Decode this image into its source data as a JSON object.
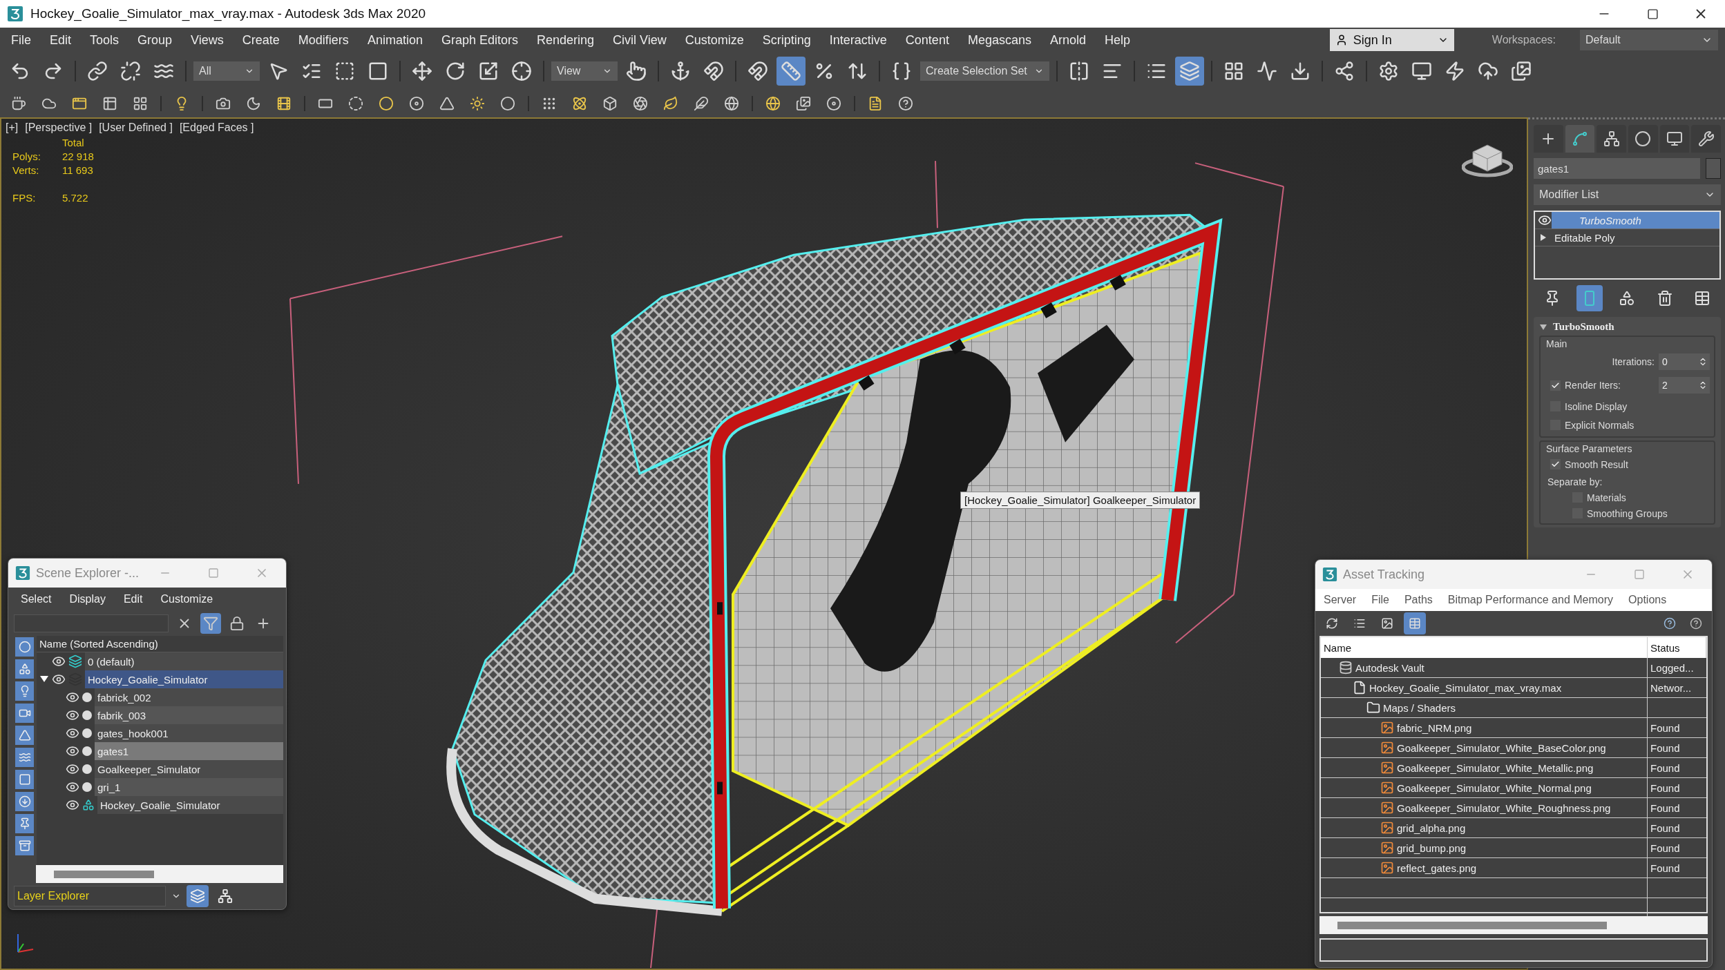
{
  "window": {
    "title": "Hockey_Goalie_Simulator_max_vray.max - Autodesk 3ds Max 2020"
  },
  "menu_bar": [
    "File",
    "Edit",
    "Tools",
    "Group",
    "Views",
    "Create",
    "Modifiers",
    "Animation",
    "Graph Editors",
    "Rendering",
    "Civil View",
    "Customize",
    "Scripting",
    "Interactive",
    "Content",
    "Megascans",
    "Arnold",
    "Help"
  ],
  "sign_in": {
    "label": "Sign In"
  },
  "workspaces": {
    "label": "Workspaces:",
    "value": "Default"
  },
  "main_toolbar": [
    {
      "items": [
        {
          "kind": "tool",
          "selected": false
        },
        {
          "kind": "tool",
          "selected": false
        }
      ]
    },
    {
      "items": [
        {
          "kind": "tool",
          "selected": false
        },
        {
          "kind": "tool",
          "selected": false
        },
        {
          "kind": "tool",
          "selected": false
        }
      ]
    },
    {
      "items": [
        {
          "kind": "dropdown",
          "value": "All"
        },
        {
          "kind": "tool",
          "selected": false
        },
        {
          "kind": "tool",
          "selected": false
        },
        {
          "kind": "tool",
          "selected": false
        },
        {
          "kind": "tool",
          "selected": false
        }
      ]
    },
    {
      "items": [
        {
          "kind": "tool",
          "selected": false
        },
        {
          "kind": "tool",
          "selected": false
        },
        {
          "kind": "tool",
          "selected": false
        },
        {
          "kind": "tool",
          "selected": false
        }
      ]
    },
    {
      "items": [
        {
          "kind": "dropdown",
          "value": "View"
        },
        {
          "kind": "tool",
          "selected": false
        }
      ]
    },
    {
      "items": [
        {
          "kind": "tool",
          "selected": false
        },
        {
          "kind": "tool",
          "selected": false
        }
      ]
    },
    {
      "items": [
        {
          "kind": "tool",
          "selected": false
        },
        {
          "kind": "tool",
          "selected": true
        },
        {
          "kind": "tool",
          "selected": false
        },
        {
          "kind": "tool",
          "selected": false
        }
      ]
    },
    {
      "items": [
        {
          "kind": "tool",
          "selected": false
        },
        {
          "kind": "dropdown",
          "value": "Create Selection Set"
        }
      ]
    },
    {
      "items": [
        {
          "kind": "tool",
          "selected": false
        },
        {
          "kind": "tool",
          "selected": false
        }
      ]
    },
    {
      "items": [
        {
          "kind": "tool",
          "selected": false
        },
        {
          "kind": "tool",
          "selected": true
        }
      ]
    },
    {
      "items": [
        {
          "kind": "tool",
          "selected": false
        },
        {
          "kind": "tool",
          "selected": false
        },
        {
          "kind": "tool",
          "selected": false
        }
      ]
    },
    {
      "items": [
        {
          "kind": "tool",
          "selected": false
        }
      ]
    },
    {
      "items": [
        {
          "kind": "tool",
          "selected": false
        },
        {
          "kind": "tool",
          "selected": false
        },
        {
          "kind": "tool",
          "selected": false
        },
        {
          "kind": "tool",
          "selected": false
        },
        {
          "kind": "tool",
          "selected": false
        }
      ]
    }
  ],
  "viewport": {
    "labels": [
      "[+]",
      "[Perspective ]",
      "[User Defined ]",
      "[Edged Faces ]"
    ],
    "stats": {
      "header": "Total",
      "rows": [
        {
          "label": "Polys:",
          "value": "22 918"
        },
        {
          "label": "Verts:",
          "value": "11 693"
        }
      ],
      "fps": {
        "label": "FPS:",
        "value": "5.722"
      }
    },
    "tooltip": "[Hockey_Goalie_Simulator] Goalkeeper_Simulator"
  },
  "command_panel": {
    "tabs": [
      {
        "selected": false
      },
      {
        "selected": true
      },
      {
        "selected": false
      },
      {
        "selected": false
      },
      {
        "selected": false
      },
      {
        "selected": false
      }
    ],
    "object_name": "gates1",
    "modifier_list": "Modifier List",
    "stack": [
      {
        "label": "TurboSmooth",
        "kind": "modifier",
        "selected": true
      },
      {
        "label": "Editable Poly",
        "kind": "base",
        "selected": false
      }
    ],
    "stack_tools": [
      {
        "selected": false
      },
      {
        "selected": true
      },
      {
        "selected": false
      },
      {
        "selected": false
      },
      {
        "selected": false
      }
    ],
    "rollout": {
      "title": "TurboSmooth",
      "expanded": true,
      "groups": [
        {
          "title": "Main",
          "rows": [
            {
              "kind": "spinner",
              "label": "Iterations:",
              "value": "0"
            },
            {
              "kind": "check_spinner",
              "label": "Render Iters:",
              "checked": true,
              "value": "2"
            },
            {
              "kind": "checkbox",
              "label": "Isoline Display",
              "checked": false
            },
            {
              "kind": "checkbox",
              "label": "Explicit Normals",
              "checked": false
            }
          ]
        },
        {
          "title": "Surface Parameters",
          "rows": [
            {
              "kind": "checkbox",
              "label": "Smooth Result",
              "checked": true
            },
            {
              "kind": "text",
              "label": "Separate by:"
            },
            {
              "kind": "sub_checkbox",
              "label": "Materials",
              "checked": false
            },
            {
              "kind": "sub_checkbox",
              "label": "Smoothing Groups",
              "checked": false
            }
          ]
        }
      ]
    }
  },
  "scene_explorer": {
    "title": "Scene Explorer -...",
    "menu": [
      "Select",
      "Display",
      "Edit",
      "Customize"
    ],
    "search_tools": [
      {
        "selected": false
      },
      {
        "selected": true
      },
      {
        "selected": false
      },
      {
        "selected": false
      }
    ],
    "side_filters": [
      {
        "selected": true
      },
      {
        "selected": true
      },
      {
        "selected": true
      },
      {
        "selected": true
      },
      {
        "selected": true
      },
      {
        "selected": true
      },
      {
        "selected": true
      },
      {
        "selected": true
      },
      {
        "selected": true
      },
      {
        "selected": true
      }
    ],
    "column": "Name (Sorted Ascending)",
    "tree": [
      {
        "name": "0 (default)",
        "kind": "layer",
        "selected": false
      },
      {
        "name": "Hockey_Goalie_Simulator",
        "kind": "layer",
        "selected": true,
        "expanded": true,
        "children": [
          {
            "name": "fabrick_002",
            "kind": "object",
            "selected": false
          },
          {
            "name": "fabrik_003",
            "kind": "object",
            "selected": false
          },
          {
            "name": "gates_hook001",
            "kind": "object",
            "selected": false
          },
          {
            "name": "gates1",
            "kind": "object",
            "selected": true
          },
          {
            "name": "Goalkeeper_Simulator",
            "kind": "object",
            "selected": false
          },
          {
            "name": "gri_1",
            "kind": "object",
            "selected": false
          },
          {
            "name": "Hockey_Goalie_Simulator",
            "kind": "group",
            "selected": false
          }
        ]
      }
    ],
    "footer": {
      "value": "Layer Explorer",
      "modes": [
        {
          "selected": true
        },
        {
          "selected": false
        }
      ]
    }
  },
  "asset_tracking": {
    "title": "Asset Tracking",
    "menu": [
      "Server",
      "File",
      "Paths",
      "Bitmap Performance and Memory",
      "Options"
    ],
    "views": [
      {
        "selected": false
      },
      {
        "selected": false
      },
      {
        "selected": false
      },
      {
        "selected": true
      }
    ],
    "columns": [
      "Name",
      "Status"
    ],
    "tree": [
      {
        "name": "Autodesk Vault",
        "status": "Logged...",
        "kind": "vault",
        "children": [
          {
            "name": "Hockey_Goalie_Simulator_max_vray.max",
            "status": "Networ...",
            "kind": "max_file",
            "children": [
              {
                "name": "Maps / Shaders",
                "kind": "folder",
                "children": [
                  {
                    "name": "fabric_NRM.png",
                    "status": "Found",
                    "kind": "image"
                  },
                  {
                    "name": "Goalkeeper_Simulator_White_BaseColor.png",
                    "status": "Found",
                    "kind": "image"
                  },
                  {
                    "name": "Goalkeeper_Simulator_White_Metallic.png",
                    "status": "Found",
                    "kind": "image"
                  },
                  {
                    "name": "Goalkeeper_Simulator_White_Normal.png",
                    "status": "Found",
                    "kind": "image"
                  },
                  {
                    "name": "Goalkeeper_Simulator_White_Roughness.png",
                    "status": "Found",
                    "kind": "image"
                  },
                  {
                    "name": "grid_alpha.png",
                    "status": "Found",
                    "kind": "image"
                  },
                  {
                    "name": "grid_bump.png",
                    "status": "Found",
                    "kind": "image"
                  },
                  {
                    "name": "reflect_gates.png",
                    "status": "Found",
                    "kind": "image"
                  }
                ]
              }
            ]
          }
        ]
      }
    ]
  }
}
